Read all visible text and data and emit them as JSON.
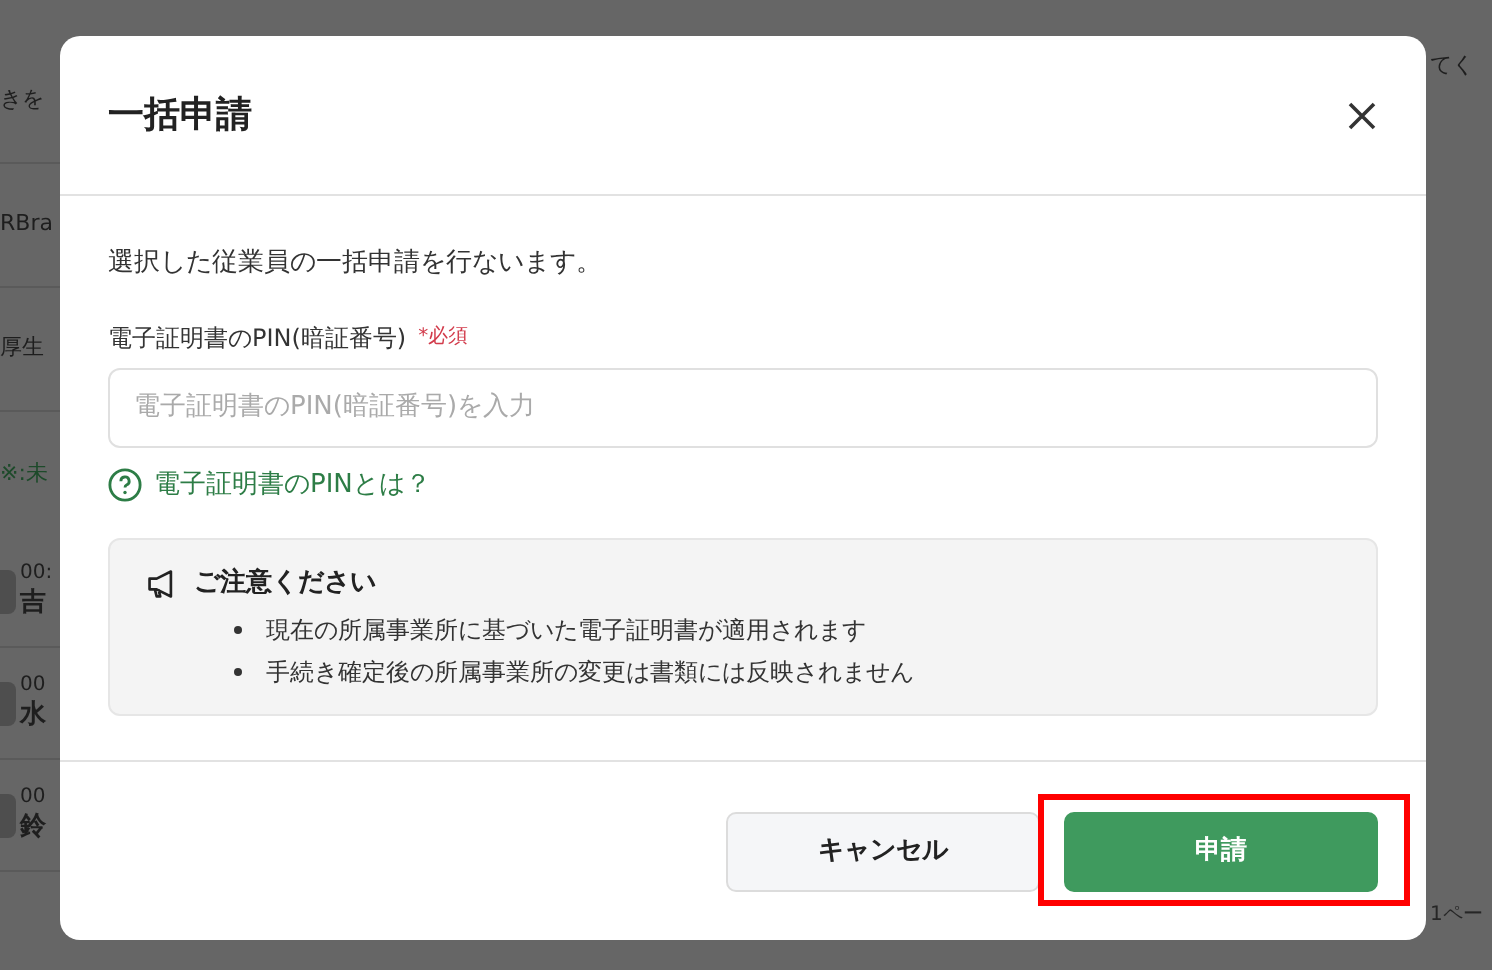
{
  "background": {
    "left_rows": [
      {
        "kind": "text",
        "text": "きを"
      },
      {
        "kind": "text",
        "text": "RBra"
      },
      {
        "kind": "text",
        "text": "厚生"
      },
      {
        "kind": "note",
        "text": "※:未"
      },
      {
        "kind": "person",
        "code": "00:",
        "name": "吉"
      },
      {
        "kind": "person",
        "code": "00",
        "name": "水"
      },
      {
        "kind": "person",
        "code": "00",
        "name": "鈴"
      }
    ],
    "right_rows": [
      {
        "kind": "text",
        "text": "てく"
      },
      {
        "kind": "pager",
        "text": "1ペー"
      }
    ]
  },
  "dialog": {
    "title": "一括申請",
    "description": "選択した従業員の一括申請を行ないます。",
    "pin_field": {
      "label": "電子証明書のPIN(暗証番号)",
      "required_mark": "*必須",
      "placeholder": "電子証明書のPIN(暗証番号)を入力"
    },
    "help_link": "電子証明書のPINとは？",
    "notice": {
      "title": "ご注意ください",
      "items": [
        "現在の所属事業所に基づいた電子証明書が適用されます",
        "手続き確定後の所属事業所の変更は書類には反映されません"
      ]
    },
    "buttons": [
      {
        "label": "キャンセル",
        "kind": "secondary",
        "highlighted": false
      },
      {
        "label": "申請",
        "kind": "primary",
        "highlighted": true
      }
    ]
  }
}
